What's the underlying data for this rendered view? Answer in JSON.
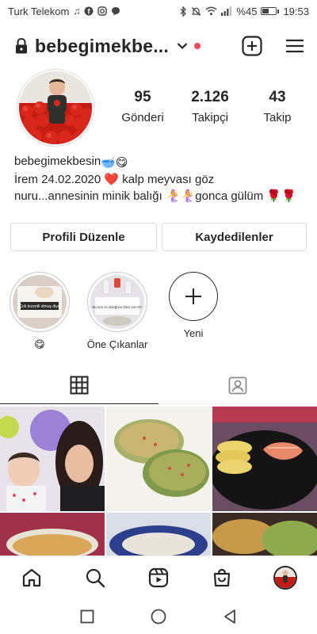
{
  "status_bar": {
    "carrier": "Turk Telekom",
    "battery": "%45",
    "time": "19:53",
    "left_icons": [
      "music-note-icon",
      "facebook-icon",
      "instagram-icon",
      "chat-icon"
    ],
    "right_icons": [
      "bluetooth-icon",
      "mute-icon",
      "wifi-icon",
      "signal-icon",
      "battery-icon"
    ]
  },
  "header": {
    "username": "bebegimekbe...",
    "has_notification_dot": true,
    "notification_color": "#ed4956"
  },
  "profile": {
    "stats": [
      {
        "value": "95",
        "label": "Gönderi"
      },
      {
        "value": "2.126",
        "label": "Takipçi"
      },
      {
        "value": "43",
        "label": "Takip"
      }
    ],
    "bio_name": "bebegimekbesin",
    "bio_name_emoji": "🥣😋",
    "bio_line1_text": "İrem 24.02.2020 ",
    "bio_heart": "❤️",
    "bio_line1_rest": " kalp meyvası göz",
    "bio_line2": "nuru...annesinin minik balığı 🧜‍♀️🧜‍♀️gonca gülüm 🌹🌹"
  },
  "buttons": {
    "edit_profile": "Profili Düzenle",
    "saved": "Kaydedilenler"
  },
  "highlights": [
    {
      "label": "😋",
      "overlay_text": "Çok tezzetli olmuş diye"
    },
    {
      "label": "Öne Çıkanlar",
      "overlay_text": "Bu nun ne olduğunu bilen var mı?"
    },
    {
      "label": "Yeni"
    }
  ],
  "tabs": [
    {
      "name": "grid",
      "icon": "grid-icon",
      "active": true
    },
    {
      "name": "tagged",
      "icon": "tagged-person-icon",
      "active": false
    }
  ],
  "bottom_nav": [
    "home-icon",
    "search-icon",
    "reels-icon",
    "shop-icon",
    "profile-avatar"
  ],
  "system_nav": [
    "recents-square-icon",
    "home-circle-icon",
    "back-triangle-icon"
  ],
  "colors": {
    "text": "#262626",
    "border": "#dbdbdb",
    "accent_red": "#ed4956"
  }
}
